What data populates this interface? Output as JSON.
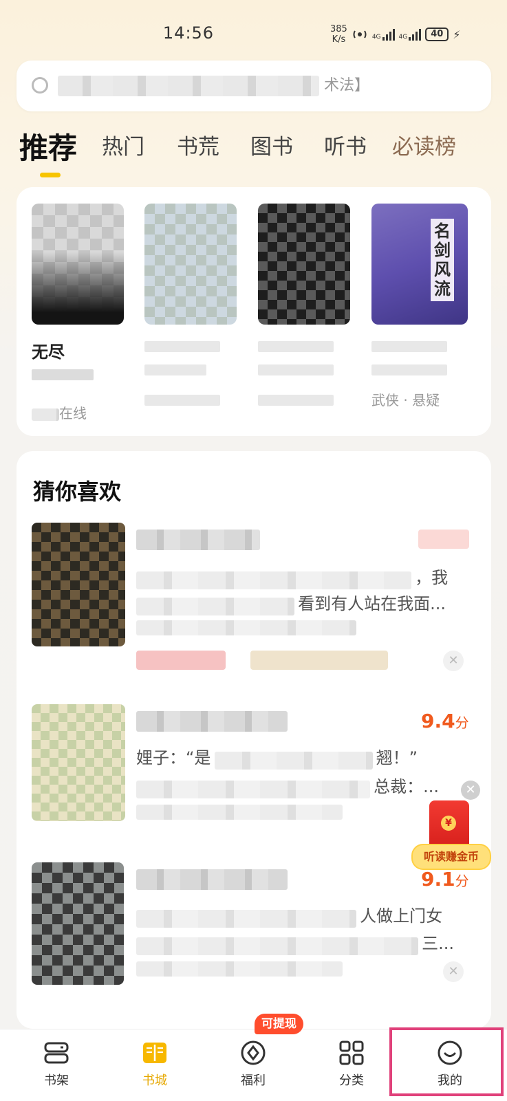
{
  "status_bar": {
    "time": "14:56",
    "speed_value": "385",
    "speed_unit": "K/s",
    "network_1": "4G",
    "network_2": "4G",
    "battery": "40"
  },
  "search": {
    "visible_tail": "术法】"
  },
  "tabs": [
    {
      "label": "推荐",
      "active": true
    },
    {
      "label": "热门"
    },
    {
      "label": "书荒"
    },
    {
      "label": "图书"
    },
    {
      "label": "听书"
    },
    {
      "label": "必读榜"
    }
  ],
  "featured": {
    "books": [
      {
        "title_partial": "无尽",
        "footer": "在线"
      },
      {
        "title_partial": "",
        "footer": ""
      },
      {
        "title_partial": "",
        "footer": ""
      },
      {
        "title_partial": "",
        "cover_title": "名剑风流",
        "footer": "武侠 · 悬疑"
      }
    ]
  },
  "guess": {
    "title": "猜你喜欢",
    "items": [
      {
        "desc_1_tail": "，我",
        "desc_2_tail": "看到有人站在我面...",
        "score": "",
        "score_unit": ""
      },
      {
        "desc_1_head": "娌子：“是",
        "desc_1_tail": "翘！”",
        "desc_2_tail": "总裁：...",
        "score": "9.4",
        "score_unit": "分"
      },
      {
        "desc_1_tail": "人做上门女",
        "desc_2_tail": "三...",
        "score": "9.1",
        "score_unit": "分"
      }
    ]
  },
  "floating": {
    "label": "听读赚金币",
    "close_icon": "close-icon"
  },
  "bottom_nav": {
    "items": [
      {
        "label": "书架",
        "icon": "bookshelf-icon"
      },
      {
        "label": "书城",
        "icon": "bookstore-icon",
        "active": true
      },
      {
        "label": "福利",
        "icon": "welfare-icon"
      },
      {
        "label": "分类",
        "icon": "category-icon"
      },
      {
        "label": "我的",
        "icon": "profile-icon"
      }
    ],
    "badge": "可提现"
  },
  "colors": {
    "accent": "#f7c400",
    "score": "#f05a1e",
    "badge": "#ff4d2d",
    "highlight": "#e0417a"
  }
}
